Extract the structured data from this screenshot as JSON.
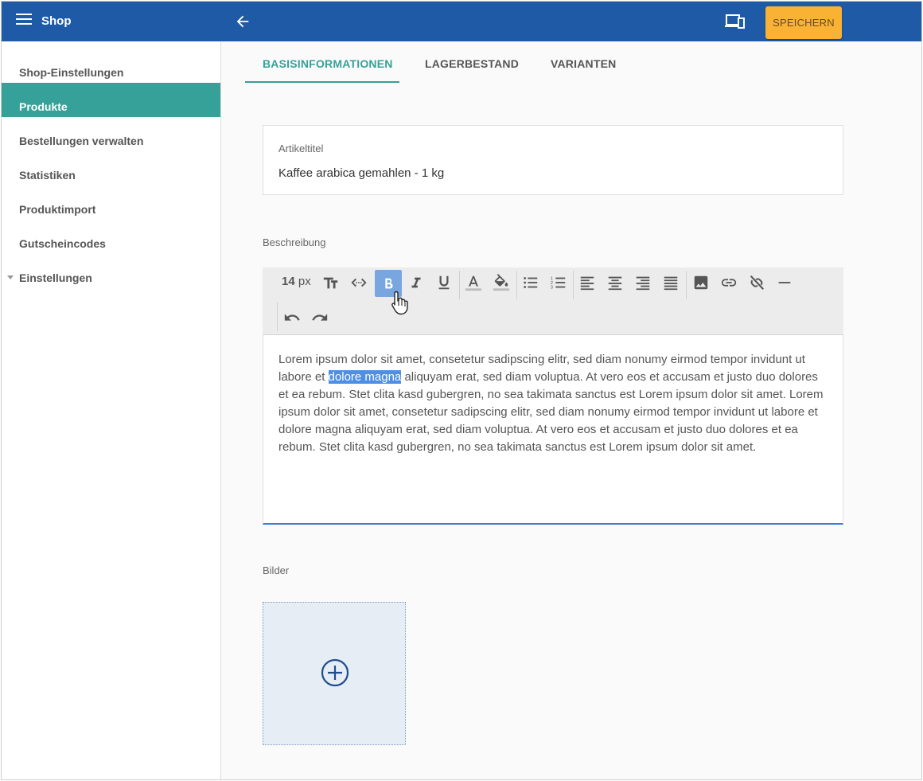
{
  "topbar": {
    "app_title": "Shop",
    "save_label": "SPEICHERN",
    "colors": {
      "bar": "#1f5aa6",
      "save": "#f9b233"
    }
  },
  "sidebar": {
    "items": [
      {
        "label": "Shop-Einstellungen",
        "active": false
      },
      {
        "label": "Produkte",
        "active": true
      },
      {
        "label": "Bestellungen verwalten",
        "active": false
      },
      {
        "label": "Statistiken",
        "active": false
      },
      {
        "label": "Produktimport",
        "active": false
      },
      {
        "label": "Gutscheincodes",
        "active": false
      },
      {
        "label": "Einstellungen",
        "active": false,
        "collapsible": true
      }
    ],
    "active_color": "#35a199"
  },
  "tabs": [
    {
      "label": "BASISINFORMATIONEN",
      "active": true
    },
    {
      "label": "LAGERBESTAND",
      "active": false
    },
    {
      "label": "VARIANTEN",
      "active": false
    }
  ],
  "article": {
    "label": "Artikeltitel",
    "value": "Kaffee arabica gemahlen - 1 kg"
  },
  "description": {
    "label": "Beschreibung",
    "toolbar": {
      "font_size_value": "14",
      "font_size_unit": "px",
      "icons": [
        "text-size-icon",
        "code-view-icon",
        "bold-icon",
        "italic-icon",
        "underline-icon",
        "font-color-icon",
        "fill-color-icon",
        "bullet-list-icon",
        "numbered-list-icon",
        "align-left-icon",
        "align-center-icon",
        "align-right-icon",
        "align-justify-icon",
        "image-icon",
        "link-icon",
        "unlink-icon",
        "horizontal-rule-icon",
        "undo-icon",
        "redo-icon"
      ],
      "active": "bold-icon"
    },
    "text_before": "Lorem ipsum dolor sit amet, consetetur sadipscing elitr, sed diam nonumy eirmod tempor invidunt ut labore et ",
    "text_selected": "dolore magna",
    "text_after": " aliquyam erat, sed diam voluptua. At vero eos et accusam et justo duo dolores et ea rebum. Stet clita kasd gubergren, no sea takimata sanctus est Lorem ipsum dolor sit amet. Lorem ipsum dolor sit amet, consetetur sadipscing elitr, sed diam nonumy eirmod tempor invidunt ut labore et dolore magna aliquyam erat, sed diam voluptua. At vero eos et accusam et justo duo dolores et ea rebum. Stet clita kasd gubergren, no sea takimata sanctus est Lorem ipsum dolor sit amet."
  },
  "images": {
    "label": "Bilder",
    "add_icon": "add-circle-icon"
  }
}
